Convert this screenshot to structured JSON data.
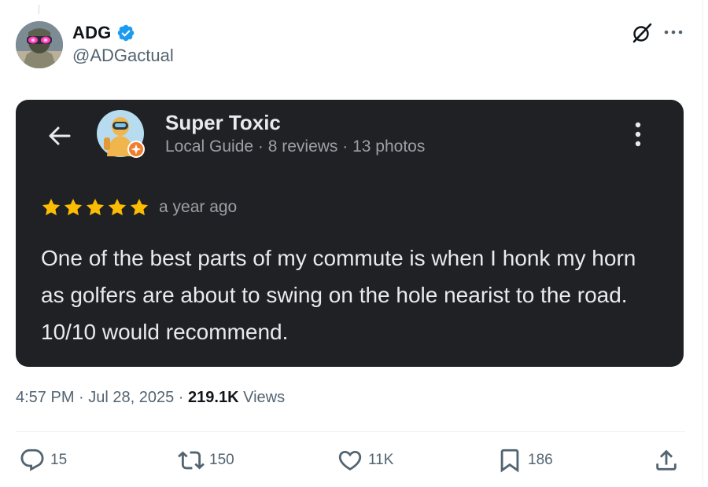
{
  "author": {
    "display_name": "ADG",
    "handle": "@ADGactual",
    "verified": true,
    "avatar_icon": "avatar-soldier-neon-goggles"
  },
  "header_actions": {
    "grok_icon": "grok-icon",
    "more_icon": "more-icon"
  },
  "review": {
    "reviewer_name": "Super Toxic",
    "reviewer_meta": "Local Guide · 8 reviews · 13 photos",
    "rating": 5,
    "rating_max": 5,
    "time": "a year ago",
    "text": "One of the best parts of my commute is when I honk my horn as golfers are about to swing on the hole nearist to the road. 10/10 would recommend."
  },
  "meta": {
    "time": "4:57 PM",
    "sep1": " · ",
    "date": "Jul 28, 2025",
    "sep2": " · ",
    "views_count": "219.1K",
    "views_label": " Views"
  },
  "actions": {
    "replies": "15",
    "reposts": "150",
    "likes": "11K",
    "bookmarks": "186"
  },
  "colors": {
    "card_bg": "#202124",
    "star": "#fbbc04",
    "verified": "#1d9bf0",
    "text_secondary": "#536471"
  }
}
